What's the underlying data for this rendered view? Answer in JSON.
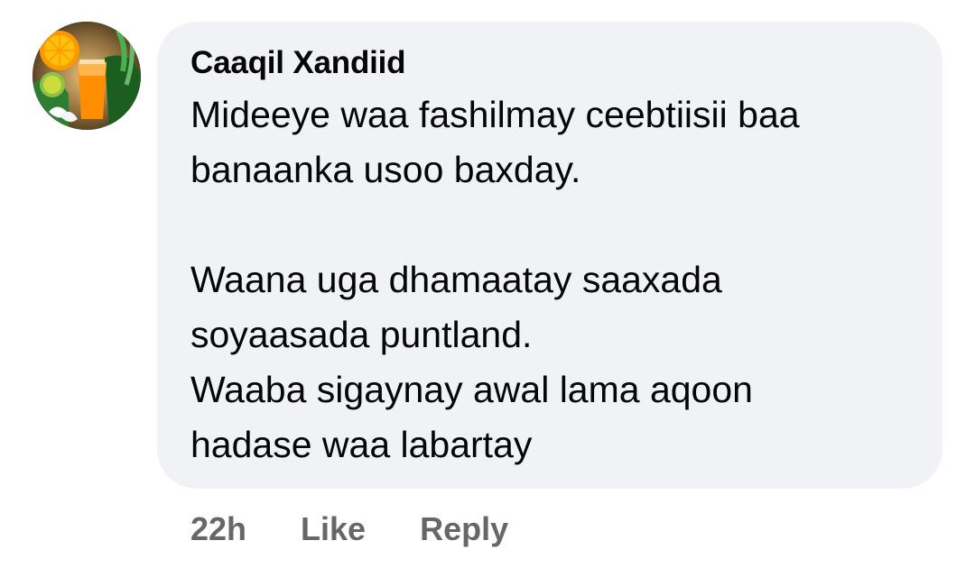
{
  "comment": {
    "author": "Caaqil Xandiid",
    "lines": [
      "Mideeye waa fashilmay ceebtiisii baa",
      "banaanka usoo baxday.",
      "",
      "Waana uga dhamaatay saaxada",
      "soyaasada puntland.",
      "Waaba sigaynay awal lama aqoon",
      "hadase waa labartay"
    ],
    "timestamp": "22h",
    "like_label": "Like",
    "reply_label": "Reply"
  },
  "colors": {
    "bubble": "#f0f2f5",
    "text": "#050505",
    "secondary": "#65676b"
  },
  "avatar_icon": "avatar-orange-juice-icon"
}
